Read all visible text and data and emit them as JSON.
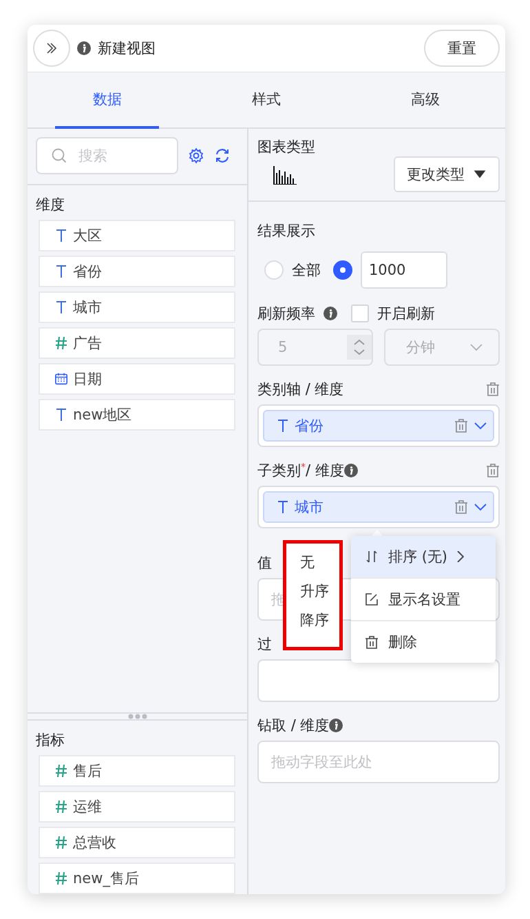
{
  "header": {
    "title": "新建视图",
    "reset_button": "重置"
  },
  "tabs": [
    {
      "label": "数据",
      "selected": true
    },
    {
      "label": "样式",
      "selected": false
    },
    {
      "label": "高级",
      "selected": false
    }
  ],
  "search": {
    "placeholder": "搜索"
  },
  "dimensions": {
    "title": "维度",
    "fields": [
      {
        "kind": "text",
        "name": "大区"
      },
      {
        "kind": "text",
        "name": "省份"
      },
      {
        "kind": "text",
        "name": "城市"
      },
      {
        "kind": "number",
        "name": "广告"
      },
      {
        "kind": "date",
        "name": "日期"
      },
      {
        "kind": "text",
        "name": "new地区"
      }
    ]
  },
  "measures": {
    "title": "指标",
    "fields": [
      {
        "kind": "number",
        "name": "售后"
      },
      {
        "kind": "number",
        "name": "运维"
      },
      {
        "kind": "number",
        "name": "总营收"
      },
      {
        "kind": "number",
        "name": "new_售后"
      }
    ]
  },
  "chart_type": {
    "label": "图表类型",
    "change_button": "更改类型"
  },
  "result_display": {
    "label": "结果展示",
    "options": [
      {
        "kind": "all",
        "label": "全部",
        "selected": false
      },
      {
        "kind": "limit",
        "value": "1000",
        "selected": true
      }
    ]
  },
  "refresh": {
    "label": "刷新频率",
    "checkbox": {
      "label": "开启刷新",
      "checked": false
    },
    "interval": "5",
    "unit": "分钟",
    "disabled": true
  },
  "zones": [
    {
      "label": "类别轴 / 维度",
      "info": false,
      "clearable": true,
      "fields": [
        {
          "kind": "text",
          "name": "省份"
        }
      ]
    },
    {
      "label": "子类别",
      "required_mark": "*",
      "suffix": " / 维度",
      "info": true,
      "clearable": true,
      "fields": [
        {
          "kind": "text",
          "name": "城市"
        }
      ]
    },
    {
      "label": "值",
      "info": false,
      "clearable": false,
      "placeholder": "拖"
    },
    {
      "label": "过",
      "info": false,
      "clearable": false
    },
    {
      "label": "钻取 / 维度",
      "info": true,
      "clearable": false,
      "placeholder": "拖动字段至此处"
    }
  ],
  "sort_menu": {
    "items": [
      {
        "label": "无"
      },
      {
        "label": "升序"
      },
      {
        "label": "降序"
      }
    ]
  },
  "context_menu": {
    "items": [
      {
        "kind": "sort",
        "label": "排序 (无)",
        "highlighted": true
      },
      {
        "kind": "rename",
        "label": "显示名设置",
        "highlighted": false
      },
      {
        "kind": "delete",
        "label": "删除",
        "highlighted": false
      }
    ]
  }
}
